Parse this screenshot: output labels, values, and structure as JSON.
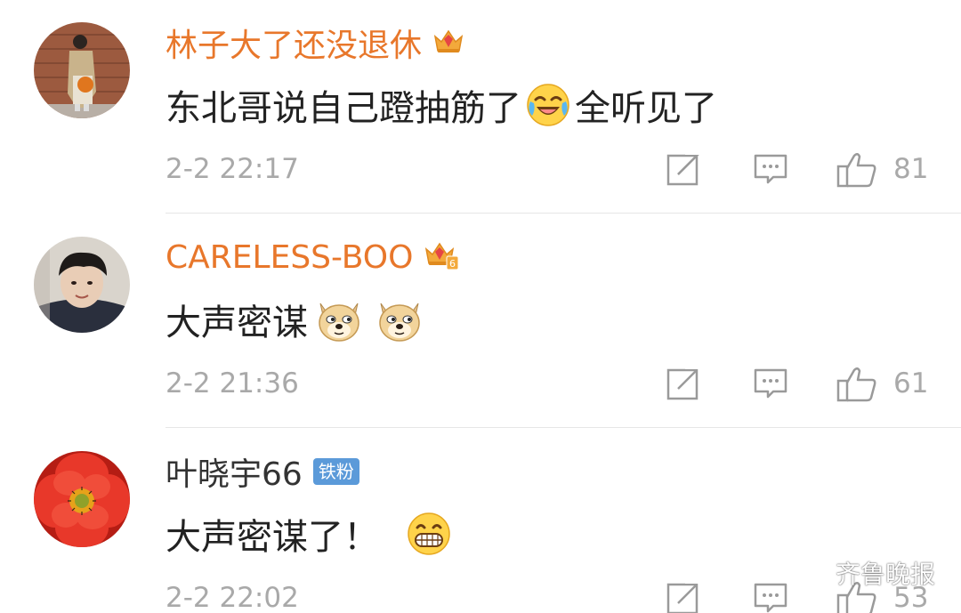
{
  "comments": [
    {
      "username": "林子大了还没退休",
      "text_before": "东北哥说自己蹬抽筋了",
      "text_after": "全听见了",
      "timestamp": "2-2 22:17",
      "likes": "81",
      "emoji": "laugh-cry",
      "badge": "crown-vip"
    },
    {
      "username": "CARELESS-BOO",
      "text_before": "大声密谋",
      "text_after": "",
      "timestamp": "2-2 21:36",
      "likes": "61",
      "emoji": "doge",
      "badge": "crown-vip-6",
      "badge_level": "6"
    },
    {
      "username": "叶晓宇66",
      "text_before": "大声密谋了！",
      "text_after": "",
      "timestamp": "2-2 22:02",
      "likes": "53",
      "emoji": "grin",
      "badge": "iron-fan",
      "badge_label": "铁粉"
    }
  ],
  "actions": {
    "share_icon": "share-edit-icon",
    "reply_icon": "comment-icon",
    "like_icon": "thumbs-up-icon"
  },
  "watermark": {
    "text": "齐鲁晚报"
  },
  "colors": {
    "vip_username": "#e8772b",
    "plain_username": "#333333",
    "meta_gray": "#a9a9a9",
    "fan_badge": "#5b9ad9",
    "divider": "#e6e6e6"
  }
}
